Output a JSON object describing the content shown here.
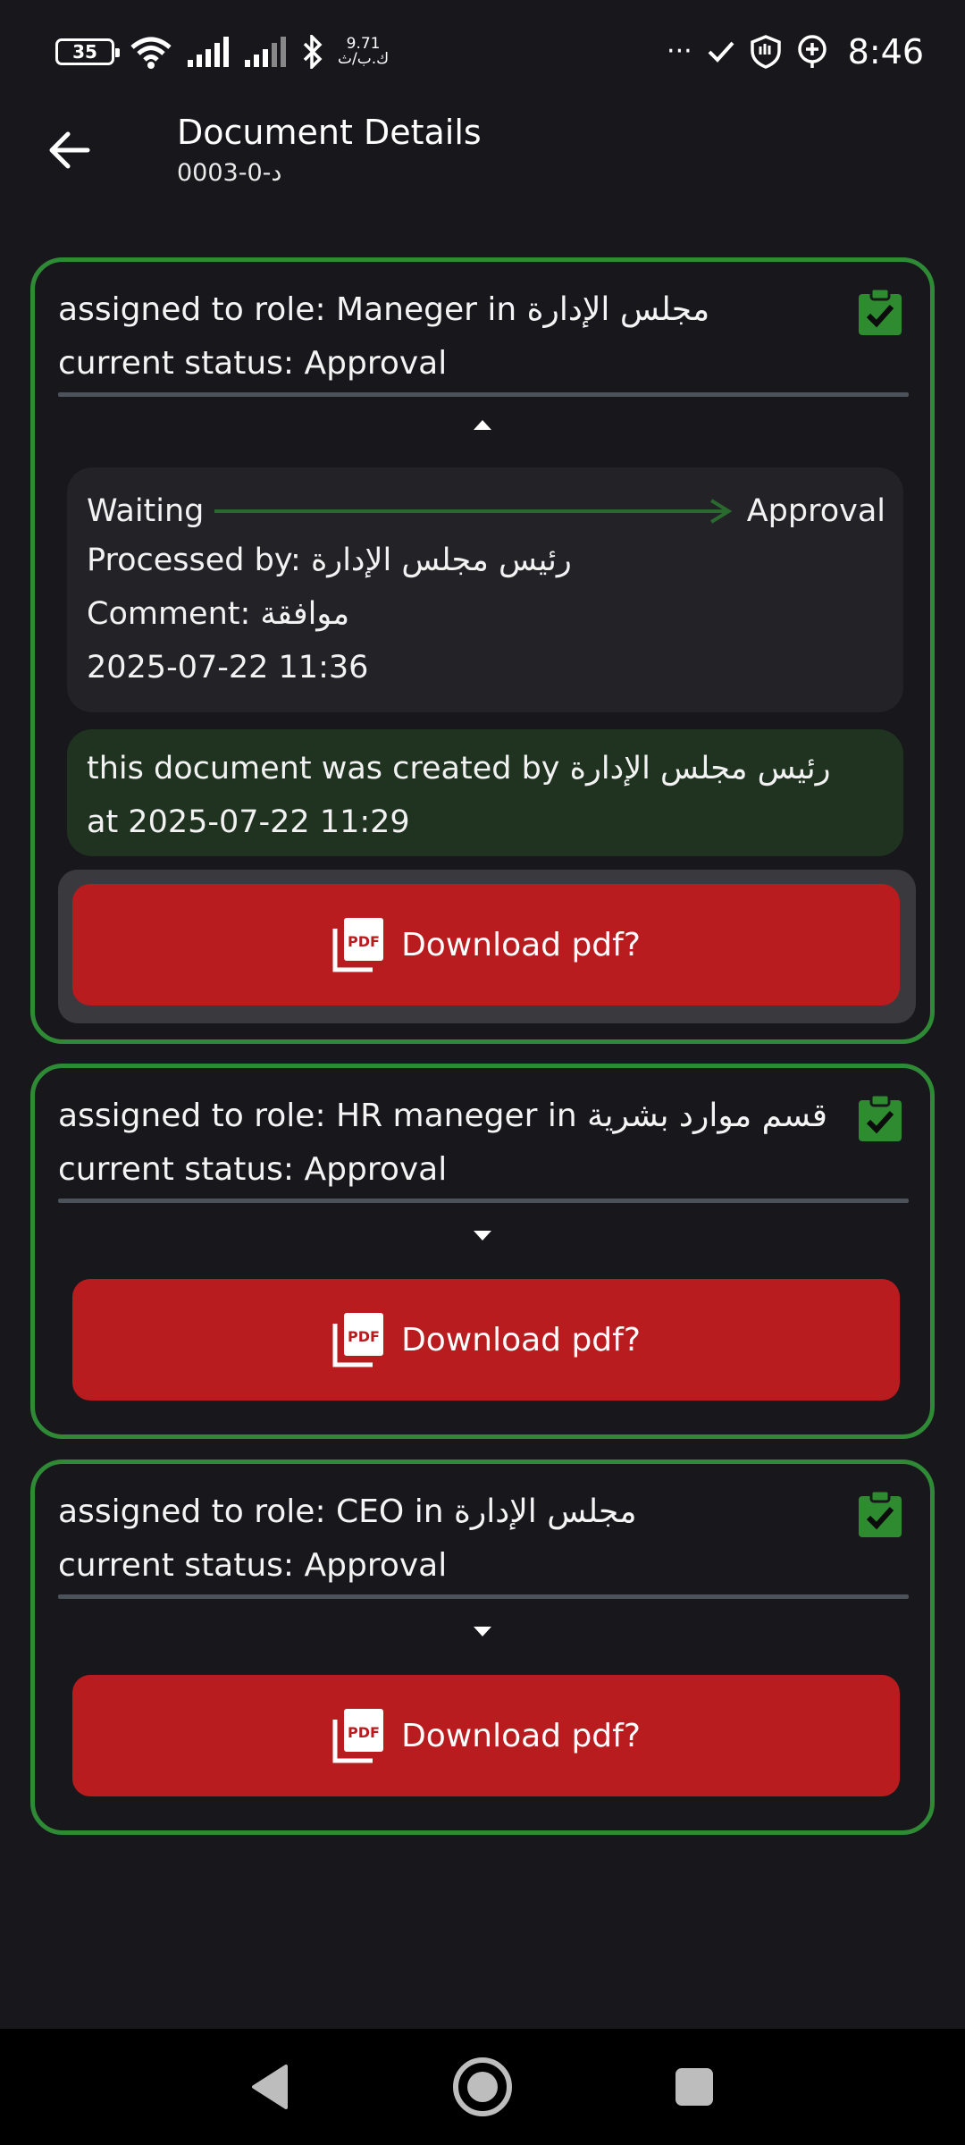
{
  "status_bar": {
    "battery": "35",
    "net_speed_value": "9.71",
    "net_speed_unit": "ك.ب/ث",
    "overflow": "···",
    "time": "8:46"
  },
  "app_bar": {
    "title": "Document Details",
    "subtitle": "د-0-0003"
  },
  "cards": [
    {
      "role_line": "assigned to role: Maneger in مجلس الإدارة",
      "status_line": "current status: Approval",
      "expanded": true,
      "history": {
        "from": "Waiting",
        "to": "Approval",
        "processed_by": "Processed by: رئيس مجلس الإدارة",
        "comment": "Comment: موافقة",
        "timestamp": "2025-07-22 11:36"
      },
      "created_line1": "this document was created by رئيس مجلس الإدارة",
      "created_line2": "at 2025-07-22 11:29",
      "download_label": "Download pdf?"
    },
    {
      "role_line": "assigned to role: HR maneger in قسم موارد بشرية",
      "status_line": "current status: Approval",
      "expanded": false,
      "download_label": "Download pdf?"
    },
    {
      "role_line": "assigned to role: CEO in مجلس الإدارة",
      "status_line": "current status: Approval",
      "expanded": false,
      "download_label": "Download pdf?"
    }
  ],
  "icons": {
    "back": "arrow-left-icon",
    "check": "clipboard-check-icon",
    "pdf": "pdf-file-icon",
    "toggle_up": "caret-up-icon",
    "toggle_down": "caret-down-icon"
  },
  "colors": {
    "background": "#18171c",
    "card_border": "#2f8a36",
    "download_button": "#b81c1e",
    "created_box": "#1f3320",
    "history_box": "#232227"
  }
}
